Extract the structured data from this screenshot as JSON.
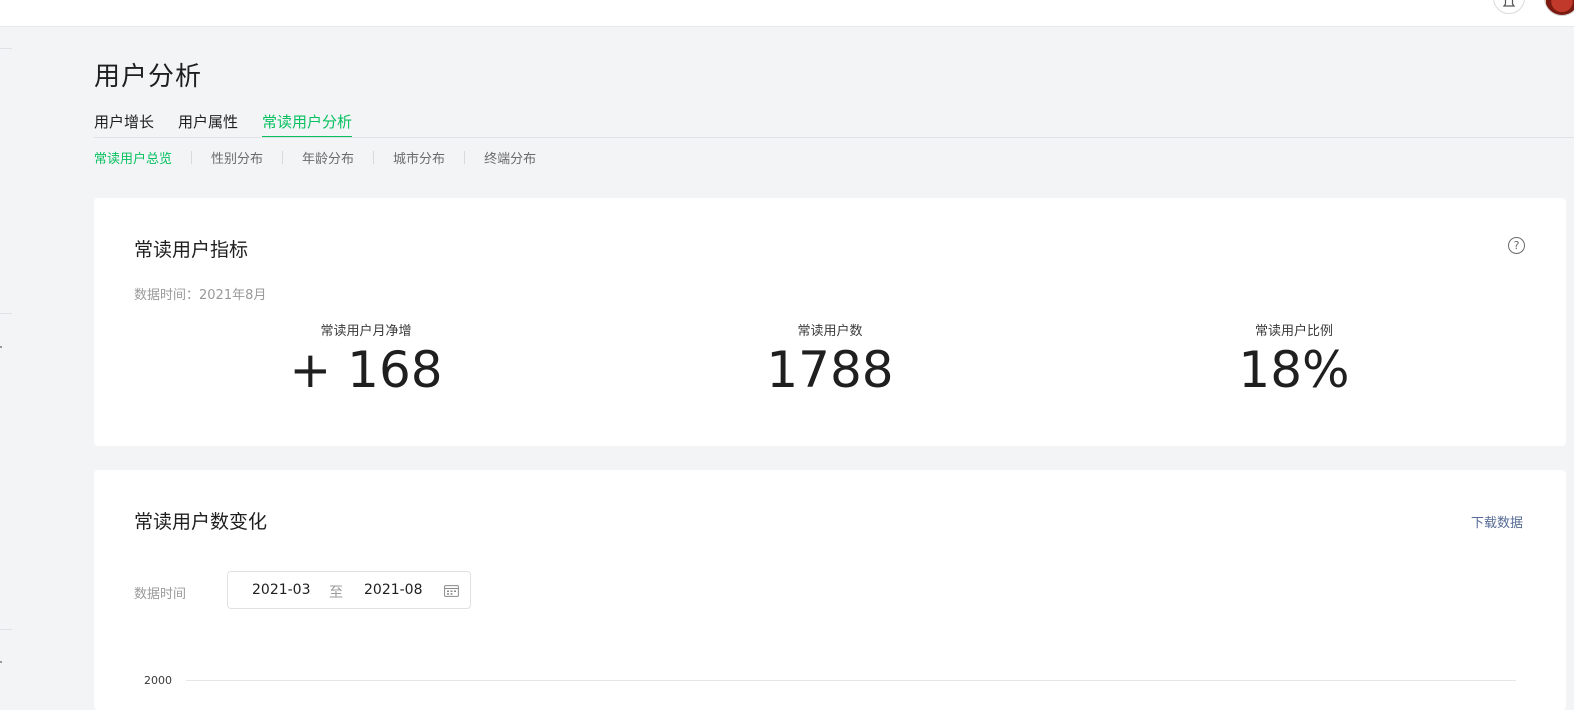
{
  "page": {
    "title": "用户分析"
  },
  "tabs": [
    {
      "label": "用户增长",
      "active": false
    },
    {
      "label": "用户属性",
      "active": false
    },
    {
      "label": "常读用户分析",
      "active": true
    }
  ],
  "subtabs": [
    {
      "label": "常读用户总览",
      "active": true
    },
    {
      "label": "性别分布",
      "active": false
    },
    {
      "label": "年龄分布",
      "active": false
    },
    {
      "label": "城市分布",
      "active": false
    },
    {
      "label": "终端分布",
      "active": false
    }
  ],
  "metrics_card": {
    "title": "常读用户指标",
    "data_time": "数据时间：2021年8月",
    "help_icon": "question-circle-icon",
    "metrics": [
      {
        "label": "常读用户月净增",
        "value": "+ 168"
      },
      {
        "label": "常读用户数",
        "value": "1788"
      },
      {
        "label": "常读用户比例",
        "value": "18%"
      }
    ]
  },
  "trend_card": {
    "title": "常读用户数变化",
    "download_label": "下载数据",
    "range_label": "数据时间",
    "range_start": "2021-03",
    "range_to": "至",
    "range_end": "2021-08",
    "calendar_icon": "calendar-icon",
    "y_tick_top": "2000"
  },
  "colors": {
    "accent": "#07c160",
    "link": "#576b95",
    "background": "#f3f4f6"
  }
}
